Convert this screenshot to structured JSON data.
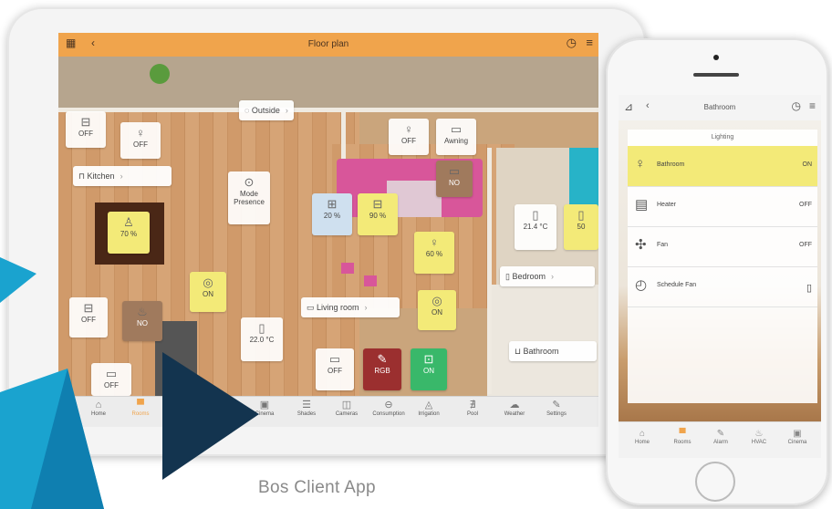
{
  "tablet": {
    "title": "Floor plan",
    "cards": [
      {
        "name": "kitchen-light-card",
        "icon": "⊟",
        "text": "OFF"
      },
      {
        "name": "outside-light-card",
        "icon": "♀",
        "text": "OFF"
      },
      {
        "name": "outside-light2-card",
        "icon": "♀",
        "text": "OFF"
      },
      {
        "name": "awning-card",
        "icon": "▭",
        "text": "Awning"
      },
      {
        "name": "mode-presence-card",
        "icon": "⊙",
        "text": "Mode Presence"
      },
      {
        "name": "dining-light-card",
        "icon": "♙",
        "text": "70 %"
      },
      {
        "name": "blind-card",
        "icon": "⊞",
        "text": "20 %"
      },
      {
        "name": "ceiling-light-card",
        "icon": "⊟",
        "text": "90 %"
      },
      {
        "name": "lamp-card",
        "icon": "♀",
        "text": "60 %"
      },
      {
        "name": "balcony-temp-card",
        "icon": "▯",
        "text": "21.4 °C"
      },
      {
        "name": "far-right-card",
        "icon": "▯",
        "text": "50"
      },
      {
        "name": "np-card",
        "icon": "▭",
        "text": "NO"
      },
      {
        "name": "living-on-card",
        "icon": "◎",
        "text": "ON"
      },
      {
        "name": "living-on2-card",
        "icon": "◎",
        "text": "ON"
      },
      {
        "name": "heater-off-card",
        "icon": "⊟",
        "text": "OFF"
      },
      {
        "name": "fire-card",
        "icon": "♨",
        "text": "NO"
      },
      {
        "name": "living-temp-card",
        "icon": "▯",
        "text": "22.0 °C"
      },
      {
        "name": "ac-card",
        "icon": "▭",
        "text": "OFF"
      },
      {
        "name": "rgb-card",
        "icon": "✎",
        "text": "RGB"
      },
      {
        "name": "socket-card",
        "icon": "⊡",
        "text": "ON"
      },
      {
        "name": "bottom-off-card",
        "icon": "▭",
        "text": "OFF"
      }
    ],
    "rooms": {
      "outside": "Outside",
      "kitchen": "Kitchen",
      "living_room": "Living room",
      "bedroom": "Bedroom",
      "bathroom": "Bathroom"
    },
    "nav": [
      "Home",
      "Rooms",
      "Cinema",
      "Shades",
      "Cameras",
      "Consumption",
      "Irrigation",
      "Pool",
      "Weather",
      "Settings"
    ]
  },
  "phone": {
    "title": "Bathroom",
    "section": "Lighting",
    "rows": [
      {
        "label": "Bathroom",
        "state": "ON",
        "icon": "bulb-icon"
      },
      {
        "label": "Heater",
        "state": "OFF",
        "icon": "radiator-icon"
      },
      {
        "label": "Fan",
        "state": "OFF",
        "icon": "fan-icon"
      },
      {
        "label": "Schedule Fan",
        "state": "",
        "icon": "clock-icon"
      }
    ],
    "nav": [
      "Home",
      "Rooms",
      "Alarm",
      "HVAC",
      "Cinema"
    ]
  },
  "caption": "Bos Client App",
  "colors": {
    "accent_orange": "#f0a44c",
    "card_yellow": "#f3ea78",
    "arrow_blue": "#1aa3cf",
    "arrow_navy": "#13344f"
  }
}
